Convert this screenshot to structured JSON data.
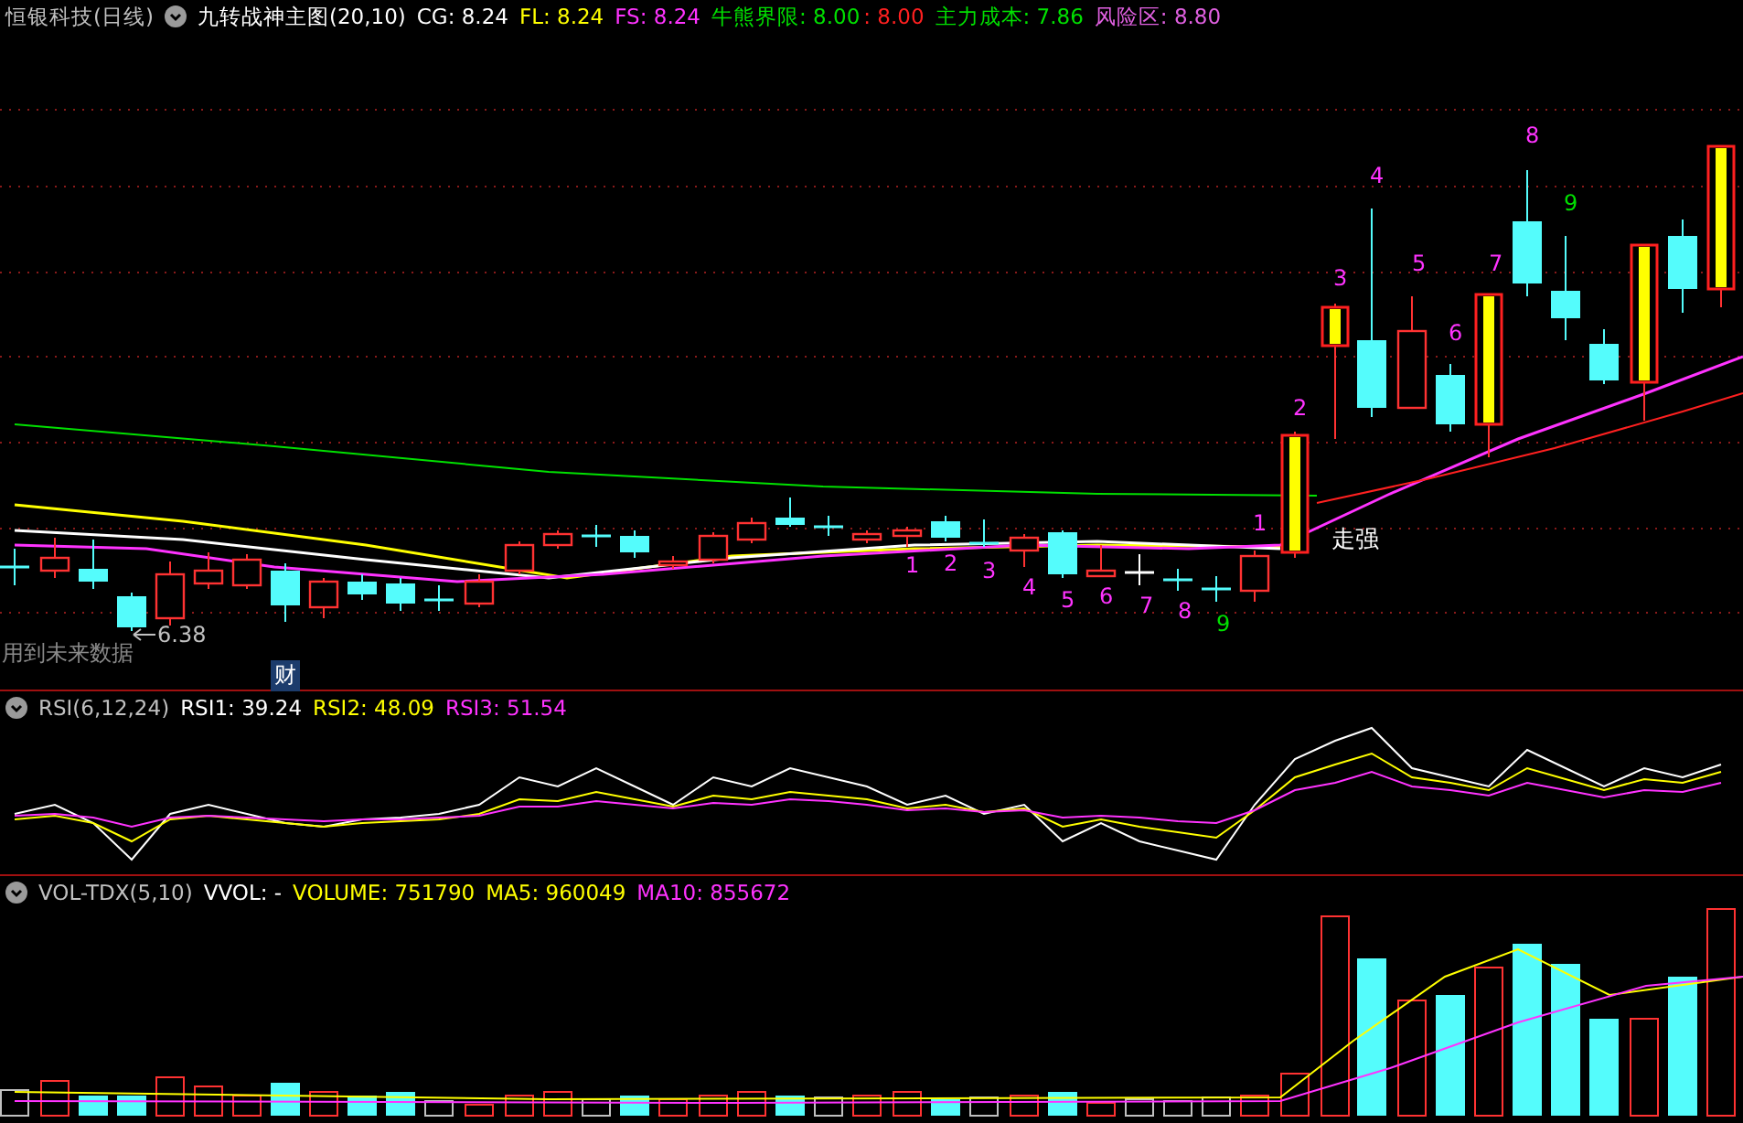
{
  "main_header": {
    "stock": "恒银科技(日线)",
    "indicator": "九转战神主图(20,10)",
    "values": [
      {
        "text": "CG: 8.24",
        "color": "#ffffff"
      },
      {
        "text": "FL: 8.24",
        "color": "#ffff00"
      },
      {
        "text": "FS: 8.24",
        "color": "#ff33ff"
      },
      {
        "text": "牛熊界限: 8.00",
        "color": "#00e000"
      },
      {
        "text": ": 8.00",
        "color": "#ff2020"
      },
      {
        "text": "主力成本: 7.86",
        "color": "#00e000"
      },
      {
        "text": "风险区: 8.80",
        "color": "#e060e0"
      }
    ]
  },
  "chart_labels": {
    "low_price": "6.38",
    "future_data_note": "用到未来数据",
    "finance_badge": "财",
    "trend_label": "走强"
  },
  "counters": [
    {
      "text": "1",
      "color": "#ff33ff"
    },
    {
      "text": "2",
      "color": "#ff33ff"
    },
    {
      "text": "3",
      "color": "#ff33ff"
    },
    {
      "text": "4",
      "color": "#ff33ff"
    },
    {
      "text": "5",
      "color": "#ff33ff"
    },
    {
      "text": "6",
      "color": "#ff33ff"
    },
    {
      "text": "7",
      "color": "#ff33ff"
    },
    {
      "text": "8",
      "color": "#ff33ff"
    },
    {
      "text": "9",
      "color": "#00e000"
    },
    {
      "text": "1",
      "color": "#ff33ff"
    },
    {
      "text": "2",
      "color": "#ff33ff"
    },
    {
      "text": "3",
      "color": "#ff33ff"
    },
    {
      "text": "4",
      "color": "#ff33ff"
    },
    {
      "text": "5",
      "color": "#ff33ff"
    },
    {
      "text": "6",
      "color": "#ff33ff"
    },
    {
      "text": "7",
      "color": "#ff33ff"
    },
    {
      "text": "8",
      "color": "#ff33ff"
    },
    {
      "text": "9",
      "color": "#00e000"
    }
  ],
  "rsi_header": {
    "indicator": "RSI(6,12,24)",
    "values": [
      {
        "text": "RSI1: 39.24",
        "color": "#ffffff"
      },
      {
        "text": "RSI2: 48.09",
        "color": "#ffff00"
      },
      {
        "text": "RSI3: 51.54",
        "color": "#ff33ff"
      }
    ]
  },
  "vol_header": {
    "indicator": "VOL-TDX(5,10)",
    "values": [
      {
        "text": "VVOL: -",
        "color": "#ffffff"
      },
      {
        "text": "VOLUME: 751790",
        "color": "#ffff00"
      },
      {
        "text": "MA5: 960049",
        "color": "#ffff00"
      },
      {
        "text": "MA10: 855672",
        "color": "#ff33ff"
      }
    ]
  }
}
